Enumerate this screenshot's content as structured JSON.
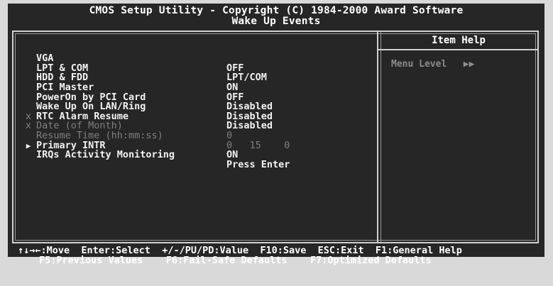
{
  "header": {
    "line1": "CMOS Setup Utility - Copyright (C) 1984-2000 Award Software",
    "line2": "Wake Up Events"
  },
  "items": [
    {
      "marker": "",
      "label": "VGA",
      "value": "OFF",
      "enabled": true
    },
    {
      "marker": "",
      "label": "LPT & COM",
      "value": "LPT/COM",
      "enabled": true
    },
    {
      "marker": "",
      "label": "HDD & FDD",
      "value": "ON",
      "enabled": true
    },
    {
      "marker": "",
      "label": "PCI Master",
      "value": "OFF",
      "enabled": true
    },
    {
      "marker": "",
      "label": "PowerOn by PCI Card",
      "value": "Disabled",
      "enabled": true
    },
    {
      "marker": "",
      "label": "Wake Up On LAN/Ring",
      "value": "Disabled",
      "enabled": true
    },
    {
      "marker": "",
      "label": "RTC Alarm Resume",
      "value": "Disabled",
      "enabled": true
    },
    {
      "marker": "x",
      "label": "Date (of Month)",
      "value": "0",
      "enabled": false
    },
    {
      "marker": "x",
      "label": "Resume Time (hh:mm:ss)",
      "value": "0   15    0",
      "enabled": false
    },
    {
      "marker": "",
      "label": "Primary INTR",
      "value": "ON",
      "enabled": true
    },
    {
      "marker": "▶",
      "label": "IRQs Activity Monitoring",
      "value": "Press Enter",
      "enabled": true
    }
  ],
  "help": {
    "title": "Item Help",
    "menu_level": "Menu Level   ▶▶"
  },
  "footer": {
    "line1": "↑↓→←:Move  Enter:Select  +/-/PU/PD:Value  F10:Save  ESC:Exit  F1:General Help",
    "line2": "F5:Previous Values    F6:Fail-Safe Defaults    F7:Optimized Defaults"
  }
}
